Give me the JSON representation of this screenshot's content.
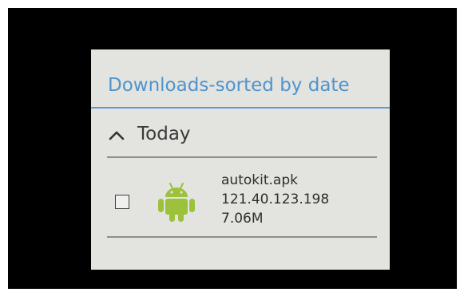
{
  "dialog": {
    "title": "Downloads-sorted by date"
  },
  "group": {
    "label": "Today",
    "icon": "chevron-up-icon"
  },
  "download": {
    "name": "autokit.apk",
    "source": "121.40.123.198",
    "size": "7.06M",
    "icon": "android-icon",
    "checked": false
  },
  "colors": {
    "background": "#000000",
    "dialog": "#e3e3e0",
    "title": "#4f94cc",
    "divider": "#8e8e8a",
    "android_green": "#9cc13a"
  }
}
